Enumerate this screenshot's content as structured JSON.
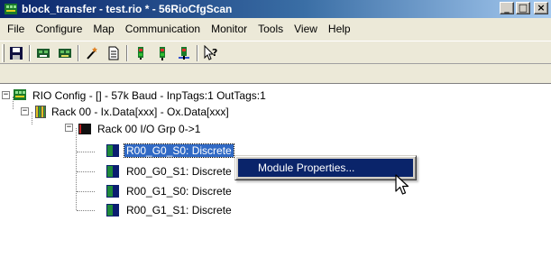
{
  "window": {
    "title": "block_transfer - test.rio * - 56RioCfgScan",
    "controls": {
      "minimize": "_",
      "maximize": "□",
      "close": "×"
    }
  },
  "menubar": {
    "items": [
      "File",
      "Configure",
      "Map",
      "Communication",
      "Monitor",
      "Tools",
      "View",
      "Help"
    ]
  },
  "toolbar": {
    "buttons": [
      "save-icon",
      "network-icon",
      "network-config-icon",
      "wand-icon",
      "document-icon",
      "monitor-green-icon",
      "monitor-red-icon",
      "monitor-plug-icon",
      "help-pointer-icon"
    ]
  },
  "tree": {
    "root": {
      "label": "RIO Config - [] -  57k Baud - InpTags:1 OutTags:1",
      "expander": "−"
    },
    "rack": {
      "label": "Rack 00 - Ix.Data[xxx] - Ox.Data[xxx]",
      "expander": "−"
    },
    "group": {
      "label": "Rack 00 I/O Grp 0->1",
      "expander": "−"
    },
    "modules": [
      {
        "label": "R00_G0_S0: Discrete",
        "selected": true
      },
      {
        "label": "R00_G0_S1: Discrete",
        "selected": false
      },
      {
        "label": "R00_G1_S0: Discrete",
        "selected": false
      },
      {
        "label": "R00_G1_S1: Discrete",
        "selected": false
      }
    ]
  },
  "context_menu": {
    "items": [
      "Module Properties..."
    ]
  },
  "colors": {
    "title_bar_start": "#0a246a",
    "title_bar_end": "#a6caf0",
    "selection": "#316ac5",
    "menu_highlight": "#0a246a",
    "window_face": "#ece9d8"
  }
}
